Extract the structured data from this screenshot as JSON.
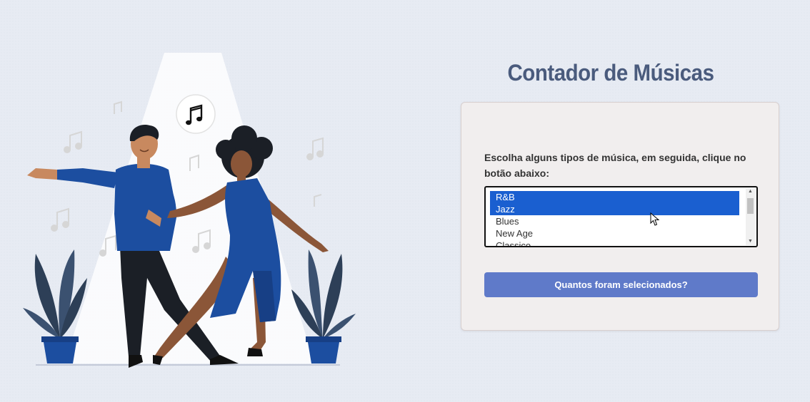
{
  "header": {
    "title": "Contador de Músicas"
  },
  "form": {
    "instruction": "Escolha alguns tipos de música, em seguida, clique no botão abaixo:",
    "options": [
      {
        "label": "R&B",
        "selected": true
      },
      {
        "label": "Jazz",
        "selected": true
      },
      {
        "label": "Blues",
        "selected": false
      },
      {
        "label": "New Age",
        "selected": false
      },
      {
        "label": "Classico",
        "selected": false
      }
    ],
    "button_label": "Quantos foram selecionados?"
  },
  "colors": {
    "title": "#4a5b7d",
    "selection": "#1a5fd0",
    "button": "#5f7ac9",
    "dress": "#1c4ea0"
  },
  "icons": [
    "music-note-icon",
    "mouse-cursor-icon"
  ]
}
